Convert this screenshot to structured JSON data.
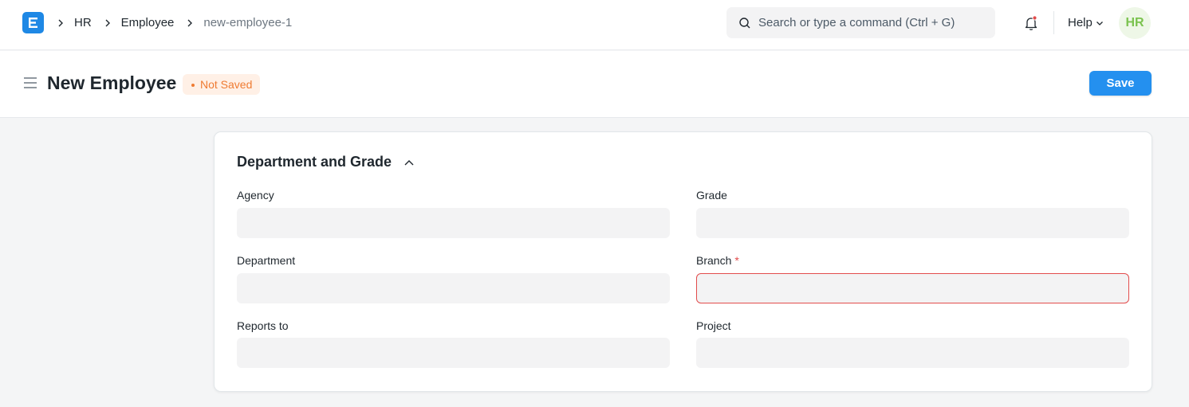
{
  "navbar": {
    "logo_letter": "E",
    "breadcrumbs": [
      "HR",
      "Employee",
      "new-employee-1"
    ],
    "search": {
      "placeholder": "Search or type a command (Ctrl + G)",
      "value": ""
    },
    "help_label": "Help",
    "avatar_initials": "HR"
  },
  "page": {
    "title": "New Employee",
    "status": "Not Saved",
    "save_label": "Save"
  },
  "section": {
    "title": "Department and Grade",
    "fields": [
      {
        "label": "Agency",
        "value": "",
        "required": false
      },
      {
        "label": "Grade",
        "value": "",
        "required": false
      },
      {
        "label": "Department",
        "value": "",
        "required": false
      },
      {
        "label": "Branch",
        "value": "",
        "required": true,
        "required_mark": "*"
      },
      {
        "label": "Reports to",
        "value": "",
        "required": false
      },
      {
        "label": "Project",
        "value": "",
        "required": false
      }
    ]
  },
  "colors": {
    "accent": "#2490ef",
    "not_saved": "#ef7b32",
    "error": "#e24c4c",
    "avatar": "#7bc34f"
  }
}
